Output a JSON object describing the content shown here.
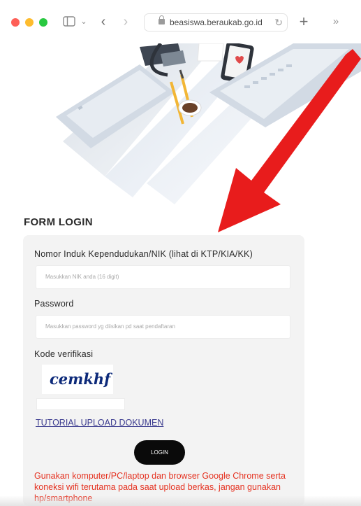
{
  "browser": {
    "url": "beasiswa.beraukab.go.id",
    "sidebar_chevron": "⌄",
    "back_glyph": "‹",
    "forward_glyph": "›",
    "reload_glyph": "↻",
    "plus_glyph": "+",
    "more_glyph": "»"
  },
  "form": {
    "title": "FORM LOGIN",
    "nik_label": "Nomor Induk Kependudukan/NIK (lihat di KTP/KIA/KK)",
    "nik_placeholder": "Masukkan NIK anda (16 digit)",
    "password_label": "Password",
    "password_placeholder": "Masukkan password yg diisikan pd saat pendaftaran",
    "captcha_label": "Kode verifikasi",
    "captcha_code": "cemkhf",
    "tutorial_link": "TUTORIAL UPLOAD DOKUMEN",
    "login_button": "LOGIN",
    "warning_text": "Gunakan komputer/PC/laptop dan browser Google Chrome serta koneksi wifi terutama pada saat upload berkas, jangan gunakan hp/smartphone"
  },
  "colors": {
    "arrow": "#e81c1c",
    "warning": "#e53322",
    "link": "#3b3b8f",
    "button": "#0a0a0a",
    "card": "#f3f3f3"
  },
  "icons": [
    "sidebar-icon",
    "chevron-down-icon",
    "back-icon",
    "forward-icon",
    "lock-icon",
    "reload-icon",
    "new-tab-icon",
    "more-icon"
  ]
}
